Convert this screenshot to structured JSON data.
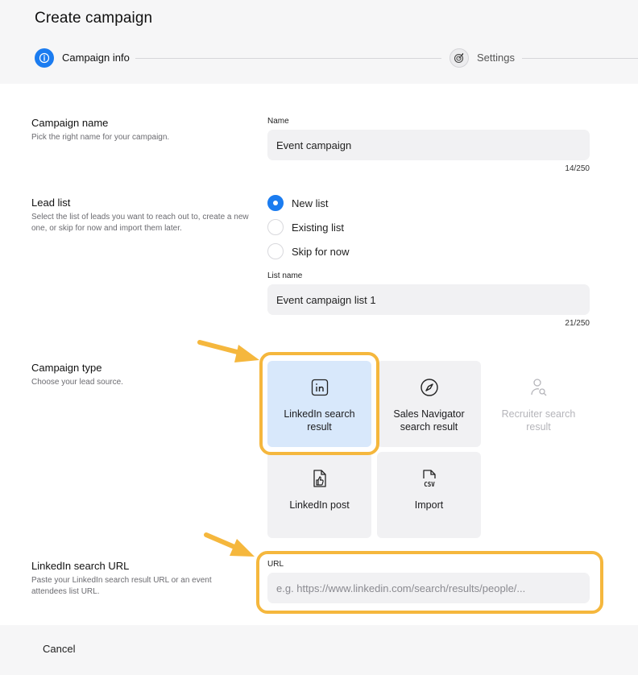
{
  "header": {
    "title": "Create campaign",
    "steps": [
      {
        "label": "Campaign info",
        "active": true
      },
      {
        "label": "Settings",
        "active": false
      }
    ]
  },
  "campaign_name": {
    "title": "Campaign name",
    "description": "Pick the right name for your campaign.",
    "field_label": "Name",
    "value": "Event campaign",
    "counter": "14/250"
  },
  "lead_list": {
    "title": "Lead list",
    "description": "Select the list of leads you want to reach out to, create a new one, or skip for now and import them later.",
    "options": [
      "New list",
      "Existing list",
      "Skip for now"
    ],
    "selected": "New list",
    "field_label": "List name",
    "value": "Event campaign list 1",
    "counter": "21/250"
  },
  "campaign_type": {
    "title": "Campaign type",
    "description": "Choose your lead source.",
    "options": [
      {
        "label": "LinkedIn search result",
        "icon": "linkedin-icon",
        "state": "selected"
      },
      {
        "label": "Sales Navigator search result",
        "icon": "compass-icon",
        "state": "default"
      },
      {
        "label": "Recruiter search result",
        "icon": "user-search-icon",
        "state": "disabled"
      },
      {
        "label": "LinkedIn post",
        "icon": "post-thumb-icon",
        "state": "default"
      },
      {
        "label": "Import",
        "icon": "csv-file-icon",
        "state": "default"
      }
    ]
  },
  "search_url": {
    "title": "LinkedIn search URL",
    "description": "Paste your LinkedIn search result URL or an event attendees list URL.",
    "field_label": "URL",
    "placeholder": "e.g. https://www.linkedin.com/search/results/people/..."
  },
  "footer": {
    "cancel_label": "Cancel"
  },
  "colors": {
    "accent": "#1b7cf0",
    "highlight": "#f5b73d",
    "selected_tile": "#d8e8fb"
  }
}
